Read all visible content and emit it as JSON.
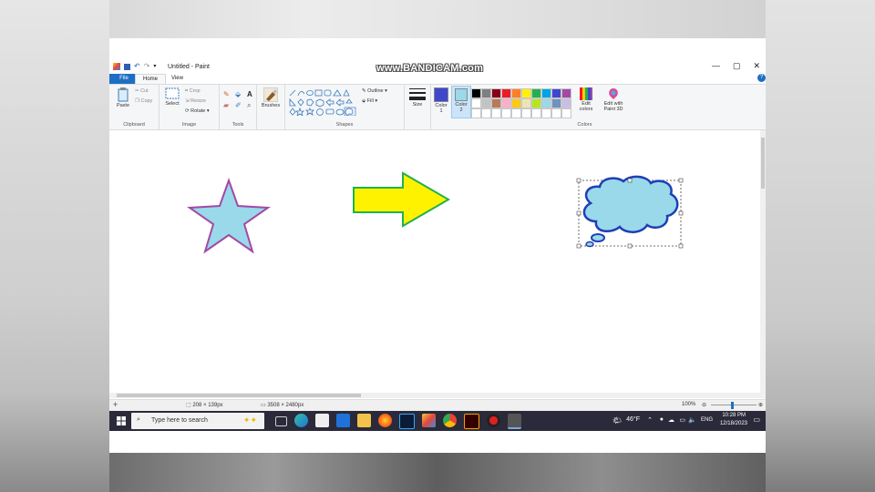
{
  "window": {
    "title": "Untitled - Paint",
    "watermark": "www.BANDICAM.com",
    "controls": {
      "minimize": "—",
      "maximize": "▢",
      "close": "✕"
    }
  },
  "tabs": {
    "file": "File",
    "home": "Home",
    "view": "View",
    "help": "?"
  },
  "ribbon": {
    "clipboard": {
      "label": "Clipboard",
      "paste": "Paste",
      "cut": "Cut",
      "copy": "Copy"
    },
    "image": {
      "label": "Image",
      "select": "Select",
      "crop": "Crop",
      "resize": "Resize",
      "rotate": "Rotate"
    },
    "tools": {
      "label": "Tools"
    },
    "brushes": {
      "label": "Brushes"
    },
    "shapes": {
      "label": "Shapes",
      "outline": "Outline",
      "fill": "Fill"
    },
    "size": {
      "label": "Size"
    },
    "colors": {
      "label": "Colors",
      "color1": "Color 1",
      "color2": "Color 2",
      "edit_colors": "Edit colors",
      "edit_paint3d": "Edit with Paint 3D",
      "color1_value": "#3f48cc",
      "color2_value": "#99d9ea",
      "palette": [
        "#000000",
        "#7f7f7f",
        "#880015",
        "#ed1c24",
        "#ff7f27",
        "#fff200",
        "#22b14c",
        "#00a2e8",
        "#3f48cc",
        "#a349a4",
        "#ffffff",
        "#c3c3c3",
        "#b97a57",
        "#ffaec9",
        "#ffc90e",
        "#efe4b0",
        "#b5e61d",
        "#99d9ea",
        "#7092be",
        "#c8bfe7",
        "#ffffff",
        "#ffffff",
        "#ffffff",
        "#ffffff",
        "#ffffff",
        "#ffffff",
        "#ffffff",
        "#ffffff",
        "#ffffff",
        "#ffffff"
      ]
    }
  },
  "canvas": {
    "shapes": [
      {
        "name": "star",
        "fill": "#99d9ea",
        "stroke": "#a349a4"
      },
      {
        "name": "right-arrow",
        "fill": "#fff200",
        "stroke": "#22b14c"
      },
      {
        "name": "thought-bubble",
        "fill": "#99d9ea",
        "stroke": "#1f3fb5"
      }
    ]
  },
  "status": {
    "selection_size": "208 × 139px",
    "image_size": "3508 × 2480px",
    "zoom": "100%"
  },
  "taskbar": {
    "search_placeholder": "Type here to search",
    "weather": "46°F",
    "language": "ENG",
    "time": "10:28 PM",
    "date": "12/18/2023"
  }
}
